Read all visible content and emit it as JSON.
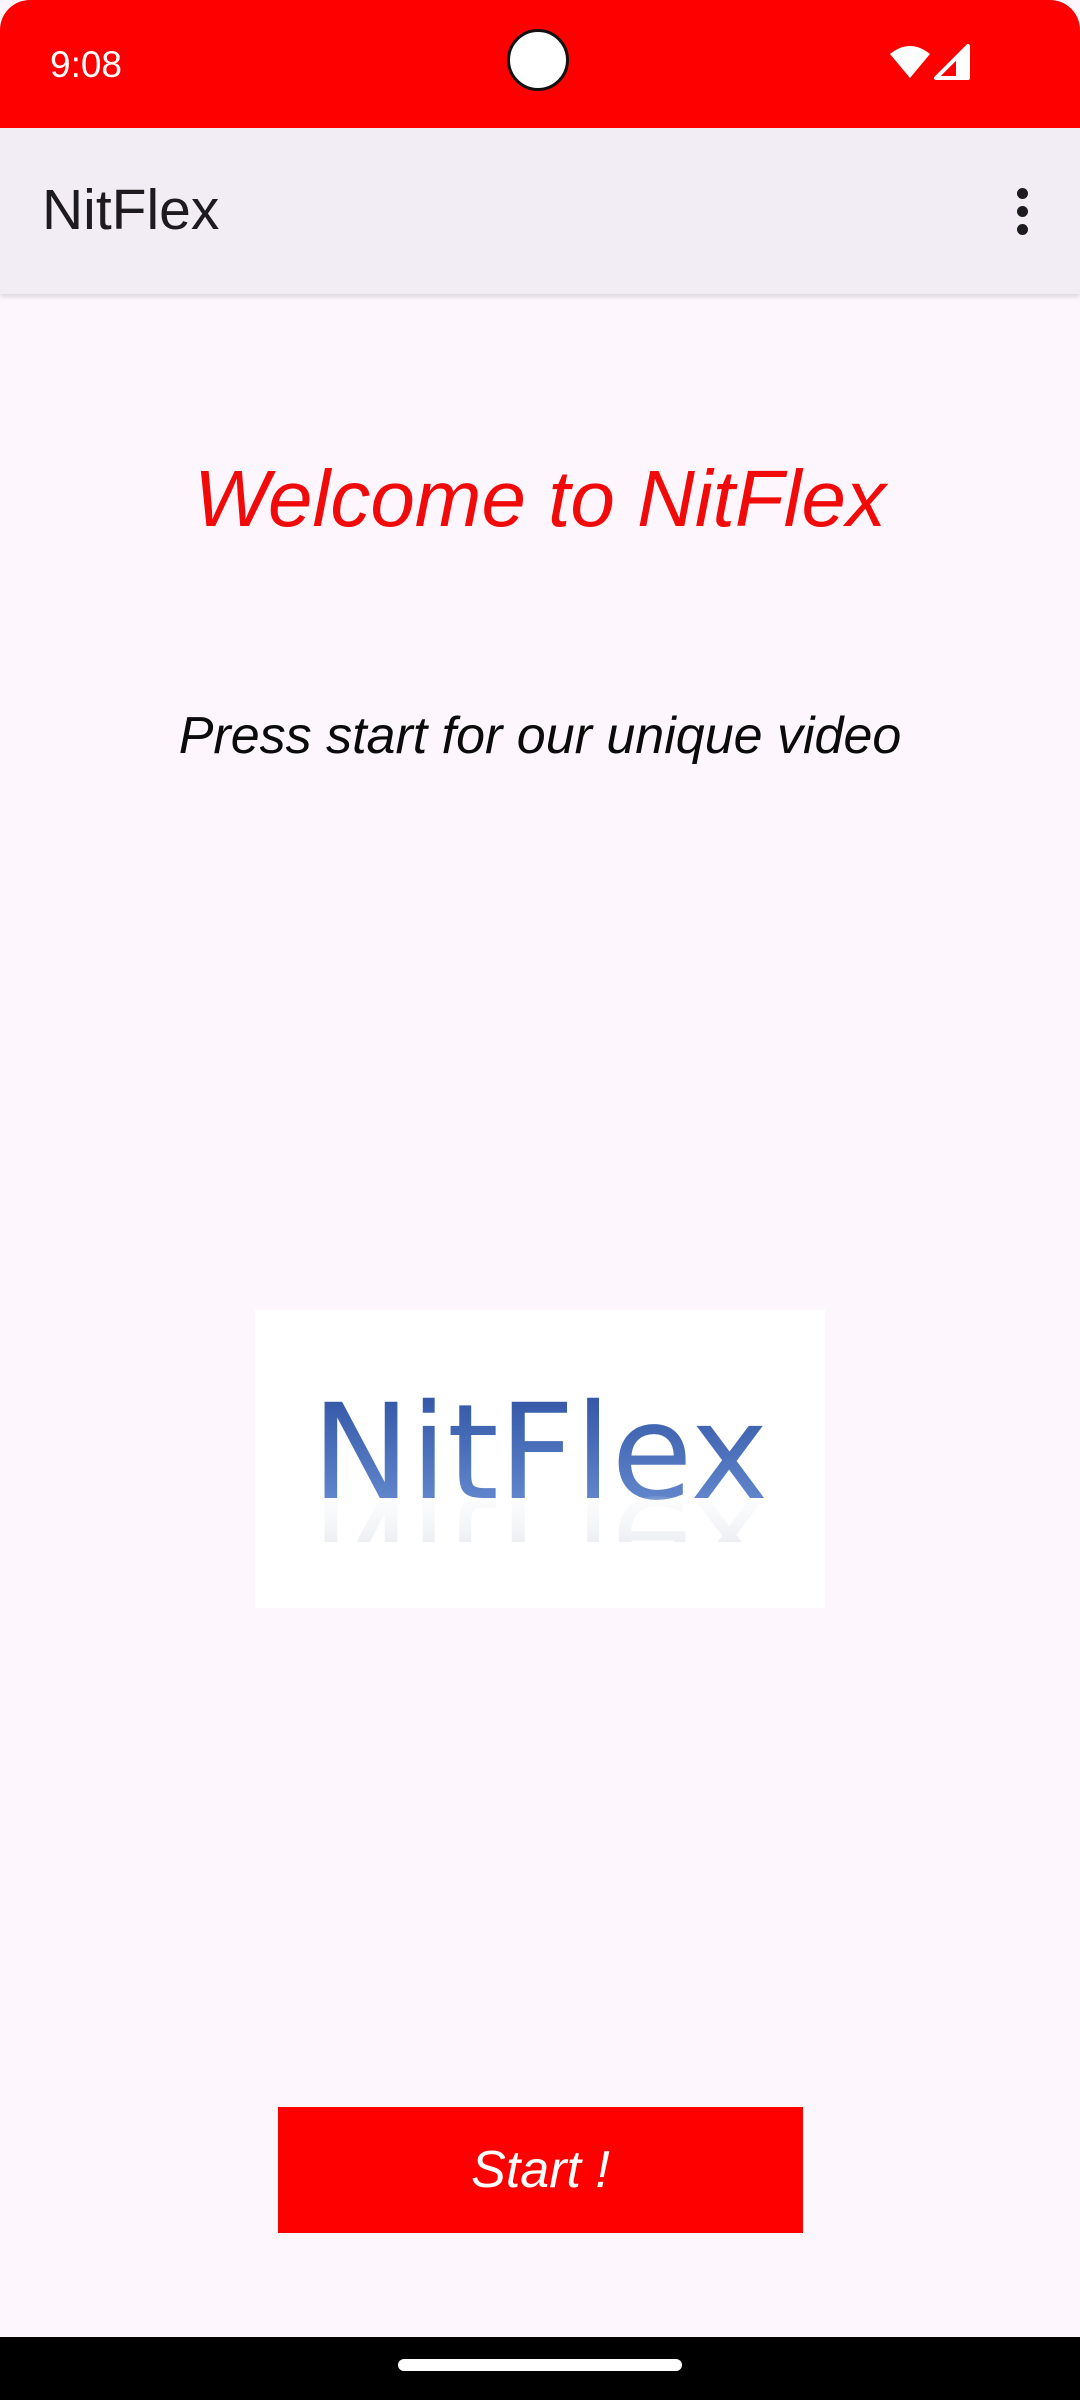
{
  "status_bar": {
    "time": "9:08",
    "background_color": "#FF0000",
    "icons": [
      "wifi-icon",
      "cellular-signal-icon"
    ]
  },
  "app_bar": {
    "title": "NitFlex",
    "overflow_icon": "more-vert-icon"
  },
  "main": {
    "welcome_text": "Welcome to NitFlex",
    "welcome_color": "#F00A0A",
    "subtitle": "Press start for our unique video",
    "logo_text": "NitFlex",
    "start_button_label": "Start !",
    "button_color": "#FF0000"
  },
  "nav_bar": {
    "handle": "gesture-handle"
  }
}
